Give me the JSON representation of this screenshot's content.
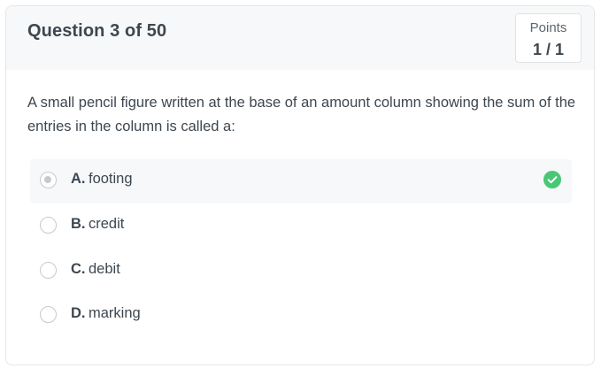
{
  "header": {
    "question_title": "Question 3 of 50",
    "points_label": "Points",
    "points_value": "1 / 1"
  },
  "question": {
    "text": "A small pencil figure written at the base of an amount column showing the sum of the entries in the column is called a:"
  },
  "options": [
    {
      "letter": "A.",
      "text": "footing",
      "selected": true,
      "correct": true
    },
    {
      "letter": "B.",
      "text": "credit",
      "selected": false,
      "correct": false
    },
    {
      "letter": "C.",
      "text": "debit",
      "selected": false,
      "correct": false
    },
    {
      "letter": "D.",
      "text": "marking",
      "selected": false,
      "correct": false
    }
  ],
  "colors": {
    "correct": "#48c774",
    "header_bg": "#f7f8f9",
    "text": "#3d4750"
  },
  "icons": {
    "correct_indicator": "check-circle-icon"
  }
}
